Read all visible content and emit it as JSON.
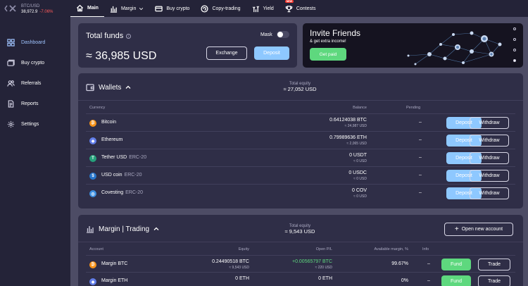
{
  "ticker": {
    "pair": "BTC/USD",
    "price": "38,972.9",
    "change": "-7.06%"
  },
  "nav": [
    {
      "label": "Main",
      "icon": "home-icon"
    },
    {
      "label": "Margin",
      "icon": "bar-chart-icon"
    },
    {
      "label": "Buy crypto",
      "icon": "card-icon"
    },
    {
      "label": "Copy-trading",
      "icon": "copy-trading-icon"
    },
    {
      "label": "Yield",
      "icon": "yield-icon"
    },
    {
      "label": "Contests",
      "icon": "trophy-icon",
      "badge": "NEW"
    }
  ],
  "sidebar": [
    {
      "label": "Dashboard",
      "icon": "dashboard-icon"
    },
    {
      "label": "Buy crypto",
      "icon": "buy-crypto-icon"
    },
    {
      "label": "Referrals",
      "icon": "referrals-icon"
    },
    {
      "label": "Reports",
      "icon": "reports-icon"
    },
    {
      "label": "Settings",
      "icon": "settings-icon"
    }
  ],
  "funds": {
    "title": "Total funds",
    "value": "≈ 36,985 USD",
    "mask_label": "Mask",
    "exchange": "Exchange",
    "deposit": "Deposit"
  },
  "invite": {
    "title": "Invite Friends",
    "subtitle": "& get extra income!",
    "button": "Get paid"
  },
  "wallets": {
    "title": "Wallets",
    "equity_label": "Total equity",
    "equity_value": "≈ 27,052 USD",
    "headers": {
      "currency": "Currency",
      "balance": "Balance",
      "pending": "Pending"
    },
    "deposit": "Deposit",
    "withdraw": "Withdraw",
    "rows": [
      {
        "name": "Bitcoin",
        "network": "",
        "balance": "0.64124038 BTC",
        "usd": "≈ 24,987 USD",
        "pending": "–",
        "color": "#f7931a"
      },
      {
        "name": "Ethereum",
        "network": "",
        "balance": "0.79989636 ETH",
        "usd": "≈ 2,065 USD",
        "pending": "–",
        "color": "#627eea"
      },
      {
        "name": "Tether USD",
        "network": "ERC-20",
        "balance": "0 USDT",
        "usd": "≈ 0 USD",
        "pending": "–",
        "color": "#26a17b"
      },
      {
        "name": "USD coin",
        "network": "ERC-20",
        "balance": "0 USDC",
        "usd": "≈ 0 USD",
        "pending": "–",
        "color": "#2775ca"
      },
      {
        "name": "Covesting",
        "network": "ERC-20",
        "balance": "0 COV",
        "usd": "≈ 0 USD",
        "pending": "–",
        "color": "#3d8fe0"
      }
    ]
  },
  "margin": {
    "title": "Margin | Trading",
    "equity_label": "Total equity",
    "equity_value": "≈ 9,543 USD",
    "open_new": "Open new account",
    "headers": {
      "account": "Account",
      "equity": "Equity",
      "open_pl": "Open P/L",
      "available": "Available margin, %",
      "info": "Info"
    },
    "fund": "Fund",
    "trade": "Trade",
    "rows": [
      {
        "name": "Margin BTC",
        "equity": "0.24490518 BTC",
        "equity_usd": "≈ 9,543 USD",
        "pl": "+0.00565797 BTC",
        "pl_usd": "≈ 220 USD",
        "available": "99.67%",
        "info": "–",
        "color": "#f7931a"
      },
      {
        "name": "Margin ETH",
        "equity": "0 ETH",
        "equity_usd": "",
        "pl": "0 ETH",
        "pl_usd": "",
        "available": "0%",
        "info": "–",
        "color": "#627eea"
      }
    ]
  }
}
